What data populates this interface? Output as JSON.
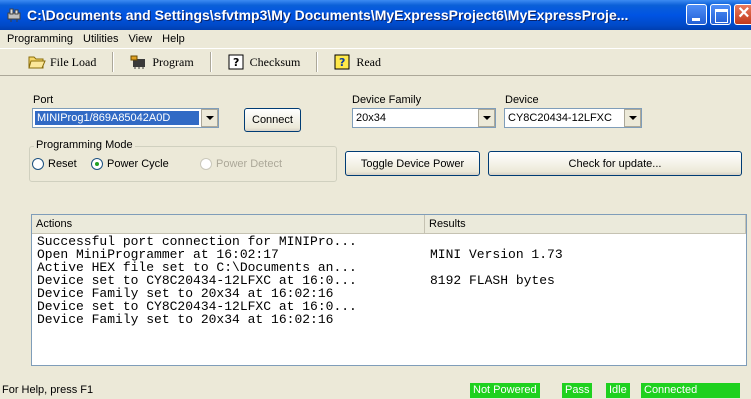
{
  "window": {
    "title": "C:\\Documents and Settings\\sfvtmp3\\My Documents\\MyExpressProject6\\MyExpressProje...",
    "icon": "programmer-app-icon"
  },
  "menu": {
    "items": [
      "Programming",
      "Utilities",
      "View",
      "Help"
    ]
  },
  "toolbar": {
    "file_load": "File Load",
    "program": "Program",
    "checksum": "Checksum",
    "read": "Read"
  },
  "form": {
    "port_label": "Port",
    "port_value": "MINIProg1/869A85042A0D",
    "connect": "Connect",
    "device_family_label": "Device Family",
    "device_family_value": "20x34",
    "device_label": "Device",
    "device_value": "CY8C20434-12LFXC",
    "programming_mode_label": "Programming Mode",
    "mode_options": [
      "Reset",
      "Power Cycle",
      "Power Detect"
    ],
    "mode_selected": "Power Cycle",
    "toggle_power": "Toggle Device Power",
    "check_update": "Check for update..."
  },
  "log": {
    "columns": [
      "Actions",
      "Results"
    ],
    "rows": [
      {
        "action": "Successful port connection for MINIPro...",
        "result": ""
      },
      {
        "action": "Open MiniProgrammer at 16:02:17",
        "result": "MINI Version 1.73"
      },
      {
        "action": "Active HEX file set to C:\\Documents an...",
        "result": ""
      },
      {
        "action": "Device set to CY8C20434-12LFXC at 16:0...",
        "result": "8192 FLASH bytes"
      },
      {
        "action": "Device Family set to 20x34 at 16:02:16",
        "result": ""
      },
      {
        "action": "Device set to CY8C20434-12LFXC at 16:0...",
        "result": ""
      },
      {
        "action": "Device Family set to 20x34 at 16:02:16",
        "result": ""
      }
    ]
  },
  "status": {
    "help": "For Help, press F1",
    "panes": [
      "Not Powered",
      "Pass",
      "Idle",
      "Connected"
    ],
    "pane_color": "#1fd11f"
  }
}
